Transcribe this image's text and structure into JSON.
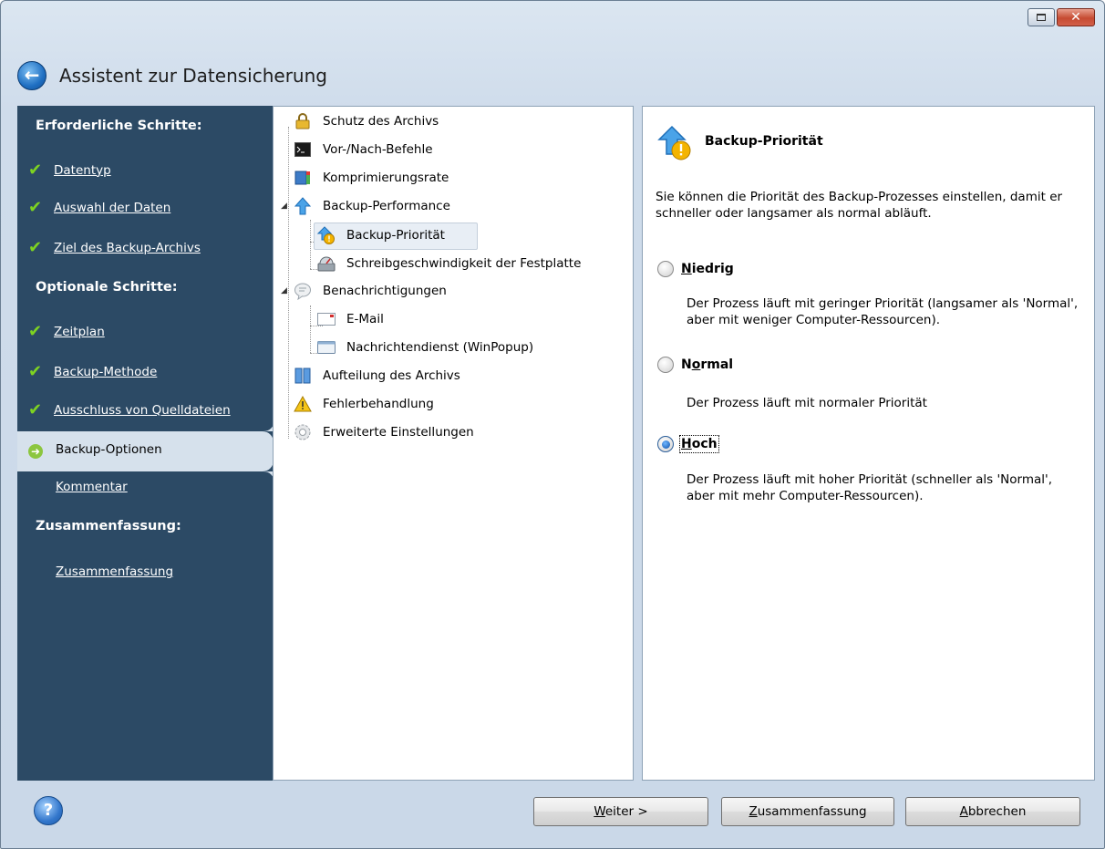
{
  "window": {
    "title": "Assistent zur Datensicherung",
    "controls": {
      "maximize_icon": "restore-icon",
      "close_symbol": "✕"
    }
  },
  "sidebar": {
    "required_heading": "Erforderliche Schritte:",
    "required_items": [
      {
        "label": "Datentyp",
        "state": "done"
      },
      {
        "label": "Auswahl der Daten",
        "state": "done"
      },
      {
        "label": "Ziel des Backup-Archivs",
        "state": "done"
      }
    ],
    "optional_heading": "Optionale Schritte:",
    "optional_items": [
      {
        "label": "Zeitplan",
        "state": "done"
      },
      {
        "label": "Backup-Methode",
        "state": "done"
      },
      {
        "label": "Ausschluss von Quelldateien",
        "state": "done"
      },
      {
        "label": "Backup-Optionen",
        "state": "active"
      },
      {
        "label": "Kommentar",
        "state": "pending"
      }
    ],
    "summary_heading": "Zusammenfassung:",
    "summary_item": "Zusammenfassung",
    "colors": {
      "background": "#2c4a65",
      "check": "#7ed321",
      "active_bg": "#d6e1ec"
    }
  },
  "tree": {
    "items": [
      {
        "label": "Schutz des Archivs",
        "icon": "lock-icon"
      },
      {
        "label": "Vor-/Nach-Befehle",
        "icon": "console-icon"
      },
      {
        "label": "Komprimierungsrate",
        "icon": "compression-icon"
      },
      {
        "label": "Backup-Performance",
        "icon": "up-arrow-icon",
        "expanded": true
      },
      {
        "label": "Backup-Priorität",
        "icon": "priority-icon",
        "selected": true
      },
      {
        "label": "Schreibgeschwindigkeit der Festplatte",
        "icon": "harddisk-speed-icon"
      },
      {
        "label": "Benachrichtigungen",
        "icon": "speech-bubble-icon",
        "expanded": true
      },
      {
        "label": "E-Mail",
        "icon": "email-icon"
      },
      {
        "label": "Nachrichtendienst (WinPopup)",
        "icon": "popup-window-icon"
      },
      {
        "label": "Aufteilung des Archivs",
        "icon": "split-archive-icon"
      },
      {
        "label": "Fehlerbehandlung",
        "icon": "warning-icon"
      },
      {
        "label": "Erweiterte Einstellungen",
        "icon": "gear-icon"
      }
    ]
  },
  "panel": {
    "title": "Backup-Priorität",
    "icon": "priority-icon",
    "description": "Sie können die Priorität des Backup-Prozesses einstellen, damit er schneller oder langsamer als normal abläuft.",
    "options": [
      {
        "label": "Niedrig",
        "mnemonic_index": 0,
        "checked": false,
        "description": "Der Prozess läuft mit geringer Priorität (langsamer als 'Normal', aber mit weniger Computer-Ressourcen)."
      },
      {
        "label": "Normal",
        "mnemonic_index": 1,
        "checked": false,
        "description": "Der Prozess läuft mit normaler Priorität"
      },
      {
        "label": "Hoch",
        "mnemonic_index": 0,
        "checked": true,
        "description": "Der Prozess läuft mit hoher Priorität (schneller als 'Normal', aber mit mehr Computer-Ressourcen)."
      }
    ]
  },
  "footer": {
    "help_symbol": "?",
    "next_button": "Weiter >",
    "summary_button": "Zusammenfassung",
    "cancel_button": "Abbrechen"
  }
}
